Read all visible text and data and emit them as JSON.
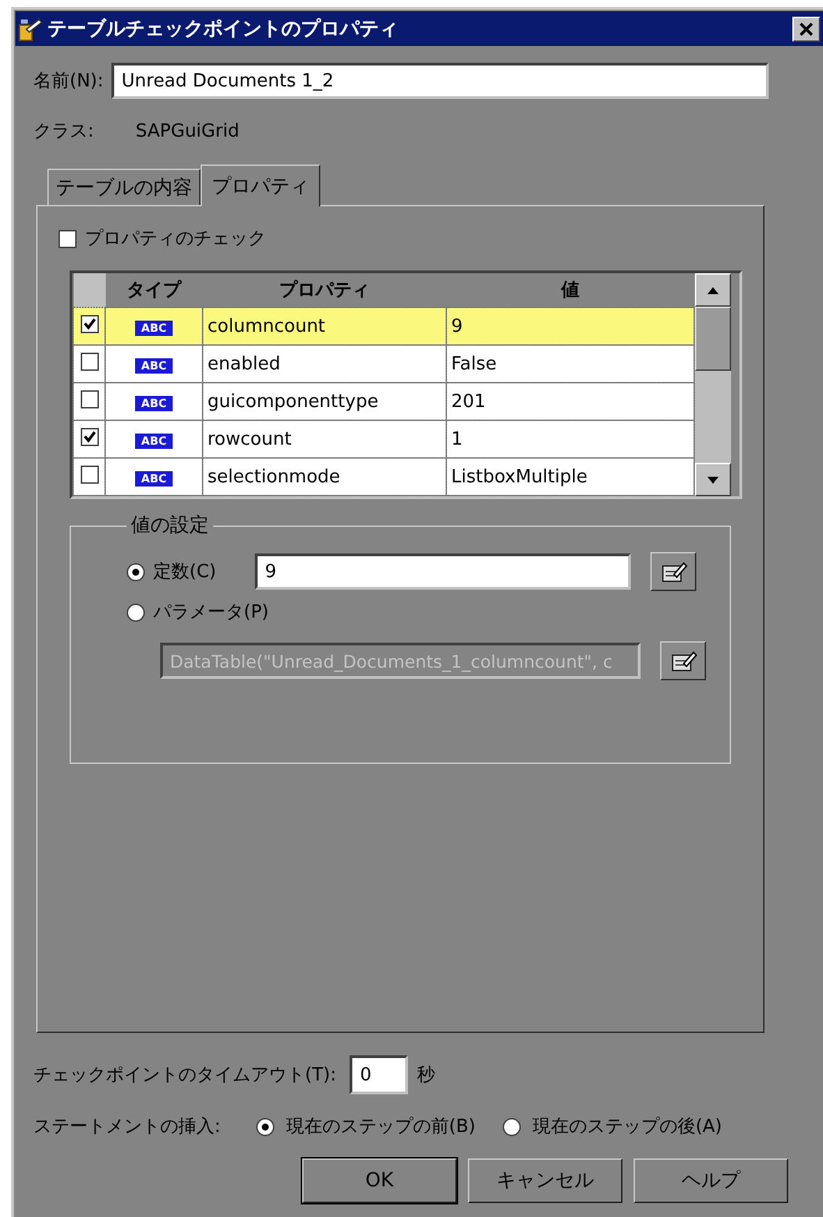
{
  "window": {
    "title": "テーブルチェックポイントのプロパティ"
  },
  "name": {
    "label": "名前(N):",
    "value": "Unread Documents 1_2"
  },
  "class": {
    "label": "クラス:",
    "value": "SAPGuiGrid"
  },
  "tabs": [
    {
      "label": "テーブルの内容",
      "selected": false
    },
    {
      "label": "プロパティ",
      "selected": true
    }
  ],
  "check_properties": {
    "label": "プロパティのチェック",
    "checked": false
  },
  "table": {
    "columns": [
      "タイプ",
      "プロパティ",
      "値"
    ],
    "rows": [
      {
        "checked": true,
        "selected": true,
        "type": "ABC",
        "property": "columncount",
        "value": "9"
      },
      {
        "checked": false,
        "selected": false,
        "type": "ABC",
        "property": "enabled",
        "value": "False"
      },
      {
        "checked": false,
        "selected": false,
        "type": "ABC",
        "property": "guicomponenttype",
        "value": "201"
      },
      {
        "checked": true,
        "selected": false,
        "type": "ABC",
        "property": "rowcount",
        "value": "1"
      },
      {
        "checked": false,
        "selected": false,
        "type": "ABC",
        "property": "selectionmode",
        "value": "ListboxMultiple"
      }
    ]
  },
  "value_settings": {
    "title": "値の設定",
    "options": [
      {
        "label": "定数(C)",
        "selected": true
      },
      {
        "label": "パラメータ(P)",
        "selected": false
      }
    ],
    "constant_value": "9",
    "parameter_value": "DataTable(\"Unread_Documents_1_columncount\", c",
    "parameter_disabled": true
  },
  "timeout": {
    "label": "チェックポイントのタイムアウト(T):",
    "value": "0",
    "unit": "秒"
  },
  "insert": {
    "label": "ステートメントの挿入:",
    "options": [
      {
        "label": "現在のステップの前(B)",
        "selected": true
      },
      {
        "label": "現在のステップの後(A)",
        "selected": false
      }
    ]
  },
  "buttons": [
    "OK",
    "キャンセル",
    "ヘルプ"
  ]
}
